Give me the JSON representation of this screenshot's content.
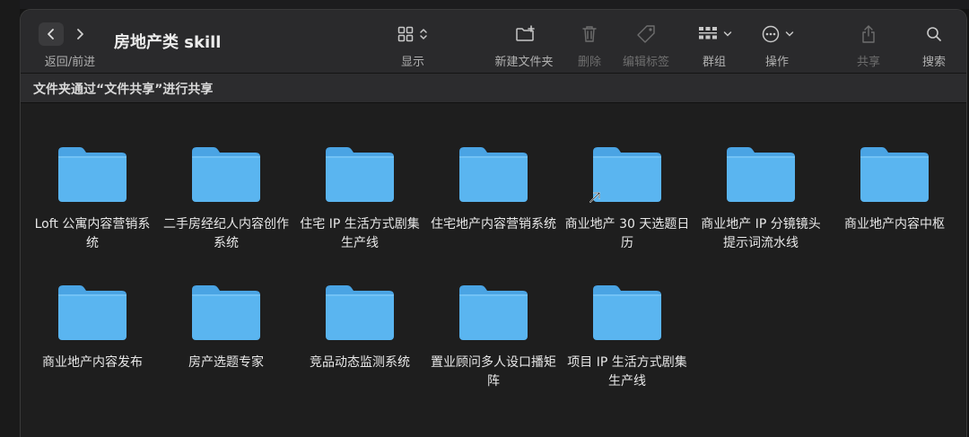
{
  "window": {
    "title": "房地产类 skill"
  },
  "toolbar": {
    "nav_caption": "返回/前进",
    "view_caption": "显示",
    "new_folder_caption": "新建文件夹",
    "delete_caption": "删除",
    "edit_tags_caption": "编辑标签",
    "group_caption": "群组",
    "action_caption": "操作",
    "share_caption": "共享",
    "search_caption": "搜索"
  },
  "share_bar": {
    "text": "文件夹通过“文件共享”进行共享"
  },
  "colors": {
    "folder_blue": "#5ab5f0",
    "folder_tab": "#4aa4e4"
  },
  "folders": [
    {
      "name": "Loft 公寓内容营销系统"
    },
    {
      "name": "二手房经纪人内容创作系统"
    },
    {
      "name": "住宅 IP 生活方式剧集生产线"
    },
    {
      "name": "住宅地产内容营销系统"
    },
    {
      "name": "商业地产 30 天选题日历"
    },
    {
      "name": "商业地产 IP 分镜镜头提示词流水线"
    },
    {
      "name": "商业地产内容中枢"
    },
    {
      "name": "商业地产内容发布"
    },
    {
      "name": "房产选题专家"
    },
    {
      "name": "竞品动态监测系统"
    },
    {
      "name": "置业顾问多人设口播矩阵"
    },
    {
      "name": "项目 IP 生活方式剧集生产线"
    }
  ]
}
